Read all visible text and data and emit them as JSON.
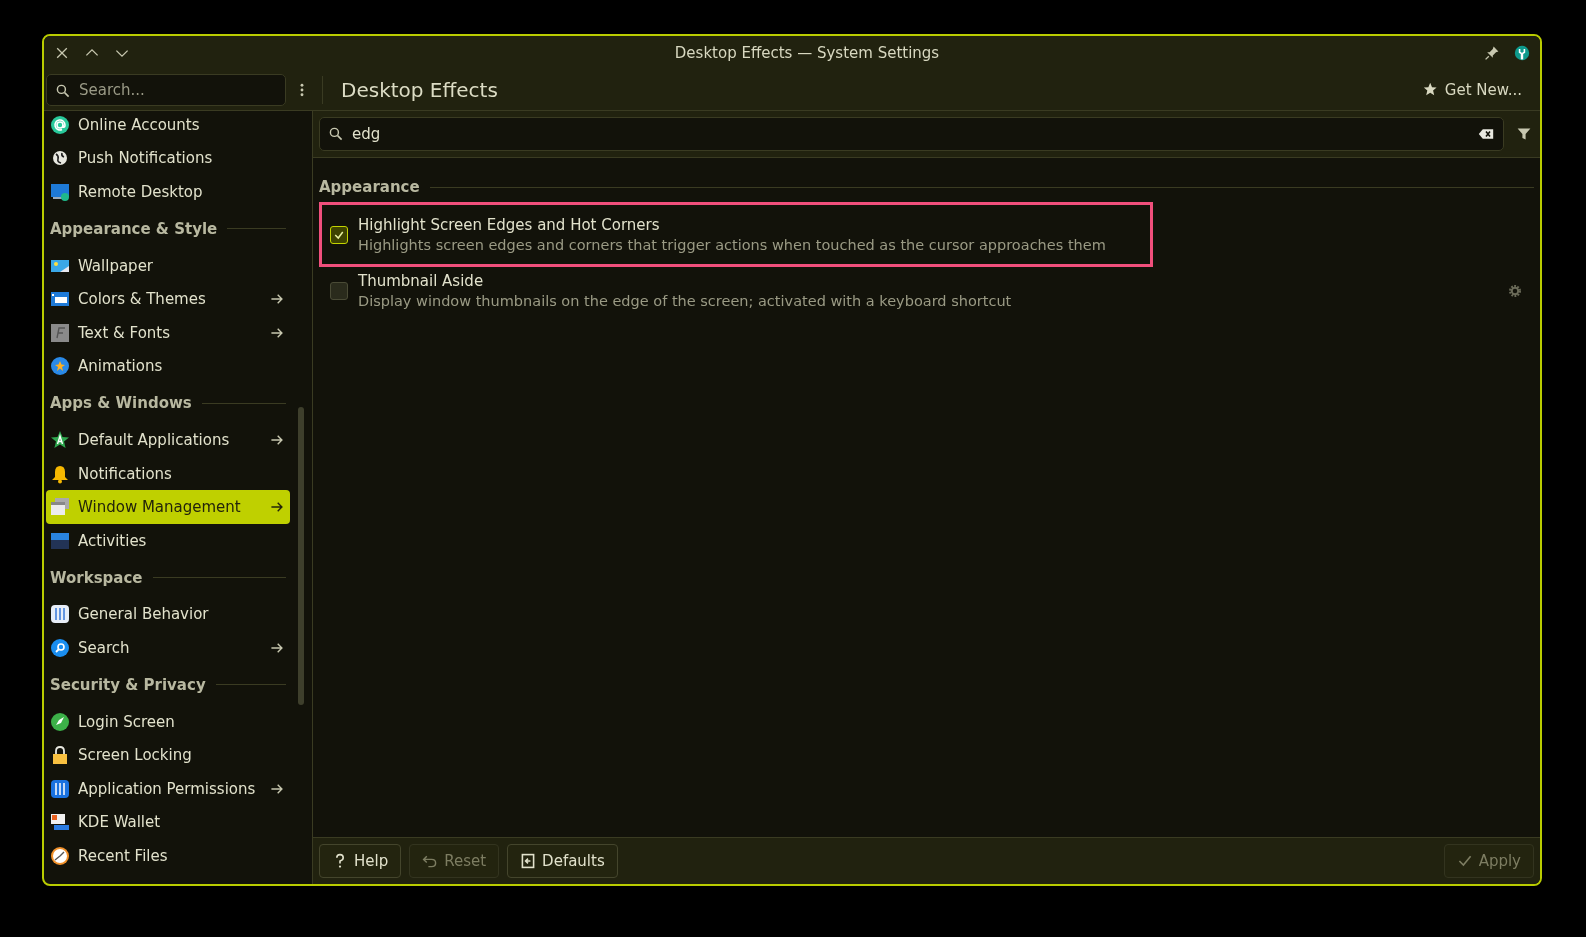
{
  "window": {
    "title": "Desktop Effects — System Settings"
  },
  "sidebar": {
    "search": {
      "placeholder": "Search..."
    },
    "items": [
      {
        "kind": "item",
        "label": "Online Accounts",
        "arrow": false,
        "selected": false
      },
      {
        "kind": "item",
        "label": "Push Notifications",
        "arrow": false,
        "selected": false
      },
      {
        "kind": "item",
        "label": "Remote Desktop",
        "arrow": false,
        "selected": false
      },
      {
        "kind": "header",
        "label": "Appearance & Style"
      },
      {
        "kind": "item",
        "label": "Wallpaper",
        "arrow": false,
        "selected": false
      },
      {
        "kind": "item",
        "label": "Colors & Themes",
        "arrow": true,
        "selected": false
      },
      {
        "kind": "item",
        "label": "Text & Fonts",
        "arrow": true,
        "selected": false
      },
      {
        "kind": "item",
        "label": "Animations",
        "arrow": false,
        "selected": false
      },
      {
        "kind": "header",
        "label": "Apps & Windows"
      },
      {
        "kind": "item",
        "label": "Default Applications",
        "arrow": true,
        "selected": false
      },
      {
        "kind": "item",
        "label": "Notifications",
        "arrow": false,
        "selected": false
      },
      {
        "kind": "item",
        "label": "Window Management",
        "arrow": true,
        "selected": true
      },
      {
        "kind": "item",
        "label": "Activities",
        "arrow": false,
        "selected": false
      },
      {
        "kind": "header",
        "label": "Workspace"
      },
      {
        "kind": "item",
        "label": "General Behavior",
        "arrow": false,
        "selected": false
      },
      {
        "kind": "item",
        "label": "Search",
        "arrow": true,
        "selected": false
      },
      {
        "kind": "header",
        "label": "Security & Privacy"
      },
      {
        "kind": "item",
        "label": "Login Screen",
        "arrow": false,
        "selected": false
      },
      {
        "kind": "item",
        "label": "Screen Locking",
        "arrow": false,
        "selected": false
      },
      {
        "kind": "item",
        "label": "Application Permissions",
        "arrow": true,
        "selected": false
      },
      {
        "kind": "item",
        "label": "KDE Wallet",
        "arrow": false,
        "selected": false
      },
      {
        "kind": "item",
        "label": "Recent Files",
        "arrow": false,
        "selected": false
      }
    ]
  },
  "page": {
    "title": "Desktop Effects",
    "get_new": "Get New...",
    "filter": {
      "value": "edg"
    },
    "group": "Appearance",
    "effects": [
      {
        "name": "Highlight Screen Edges and Hot Corners",
        "description": "Highlights screen edges and corners that trigger actions when touched as the cursor approaches them",
        "checked": true,
        "highlighted": true,
        "configurable": false
      },
      {
        "name": "Thumbnail Aside",
        "description": "Display window thumbnails on the edge of the screen; activated with a keyboard shortcut",
        "checked": false,
        "highlighted": false,
        "configurable": true
      }
    ]
  },
  "footer": {
    "buttons": [
      {
        "kind": "help",
        "label": "Help",
        "disabled": false
      },
      {
        "kind": "reset",
        "label": "Reset",
        "disabled": true
      },
      {
        "kind": "defaults",
        "label": "Defaults",
        "disabled": false
      },
      {
        "kind": "apply",
        "label": "Apply",
        "disabled": true
      }
    ]
  }
}
